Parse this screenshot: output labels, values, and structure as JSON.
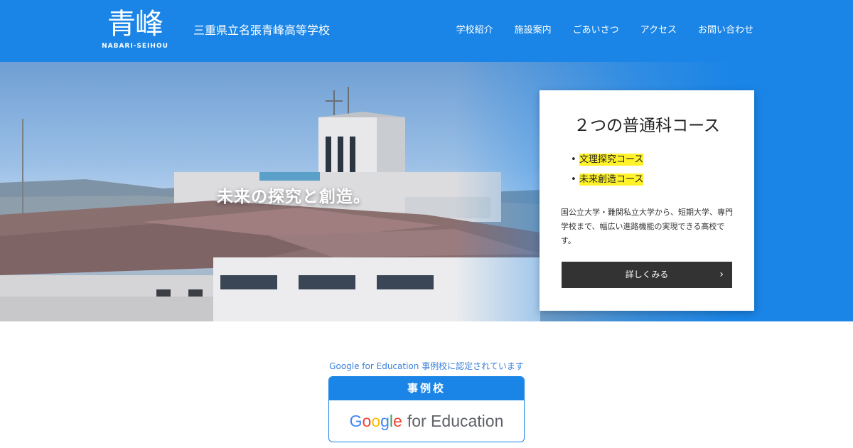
{
  "header": {
    "logo_kanji": "青峰",
    "logo_romaji": "NABARI-SEIHOU",
    "school_name": "三重県立名張青峰高等学校",
    "nav": [
      "学校紹介",
      "施設案内",
      "ごあいさつ",
      "アクセス",
      "お問い合わせ"
    ]
  },
  "hero": {
    "tagline": "未来の探究と創造。"
  },
  "card": {
    "title": "２つの普通科コース",
    "courses": [
      "文理探究コース",
      "未来創造コース"
    ],
    "description": "国公立大学・難関私立大学から、短期大学、専門学校まで、幅広い進路機能の実現できる高校です。",
    "button_label": "詳しくみる"
  },
  "gfe": {
    "note": "Google for Education 事例校に認定されています",
    "badge_top": "事例校",
    "brand_letters": [
      "G",
      "o",
      "o",
      "g",
      "l",
      "e"
    ],
    "brand_rest": "for Education"
  },
  "colors": {
    "header_blue": "#1a85e6",
    "highlight": "#fff22a",
    "button_dark": "#333333"
  }
}
